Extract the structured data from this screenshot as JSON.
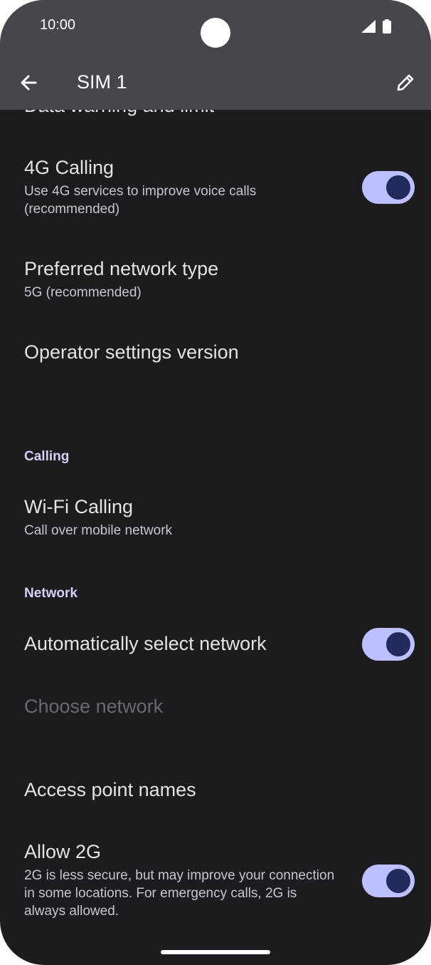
{
  "status": {
    "time": "10:00"
  },
  "appbar": {
    "title": "SIM 1"
  },
  "items": {
    "data_warning": {
      "title": "Data warning and limit"
    },
    "calling_4g": {
      "title": "4G Calling",
      "subtitle": "Use 4G services to improve voice calls (recommended)",
      "toggle": "on"
    },
    "network_type": {
      "title": "Preferred network type",
      "subtitle": "5G (recommended)"
    },
    "operator": {
      "title": "Operator settings version"
    },
    "wifi_calling": {
      "title": "Wi-Fi Calling",
      "subtitle": "Call over mobile network"
    },
    "auto_network": {
      "title": "Automatically select network",
      "toggle": "on"
    },
    "choose_network": {
      "title": "Choose network"
    },
    "apn": {
      "title": "Access point names"
    },
    "allow_2g": {
      "title": "Allow 2G",
      "subtitle": "2G is less secure, but may improve your connection in some locations. For emergency calls, 2G is always allowed.",
      "toggle": "on"
    }
  },
  "sections": {
    "calling": "Calling",
    "network": "Network"
  },
  "colors": {
    "background": "#1d1b20",
    "bar": "#48464c",
    "toggle_track": "#bcc0ff",
    "toggle_knob": "#232a5c"
  }
}
